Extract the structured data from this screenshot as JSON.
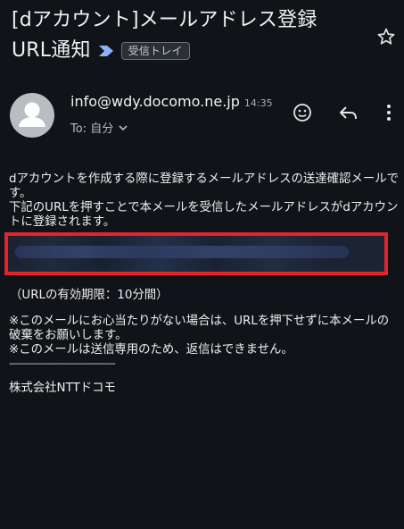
{
  "subject": {
    "line1": "[dアカウント]メールアドレス登録",
    "line2": "URL通知",
    "label_chip": "受信トレイ"
  },
  "sender": {
    "email": "info@wdy.docomo.ne.jp",
    "time": "14:35",
    "to_label": "To: 自分"
  },
  "body": {
    "paragraph1": "dアカウントを作成する際に登録するメールアドレスの送達確認メールです。",
    "paragraph2": "下記のURLを押すことで本メールを受信したメールアドレスがdアカウントに登録されます。",
    "validity": "（URLの有効期限：10分間）",
    "note1": "※このメールにお心当たりがない場合は、URLを押下せずに本メールの破棄をお願いします。",
    "note2": "※このメールは送信専用のため、返信はできません。",
    "dashes": "----------------------------------------",
    "company": "株式会社NTTドコモ"
  },
  "colors": {
    "background": "#101418",
    "redaction_border": "#e3242b",
    "label_arrow": "#8ab4f8"
  },
  "icons": [
    "star-icon",
    "avatar-person-icon",
    "chevron-down-icon",
    "emoji-icon",
    "reply-icon",
    "more-vert-icon",
    "label-arrow-icon"
  ]
}
